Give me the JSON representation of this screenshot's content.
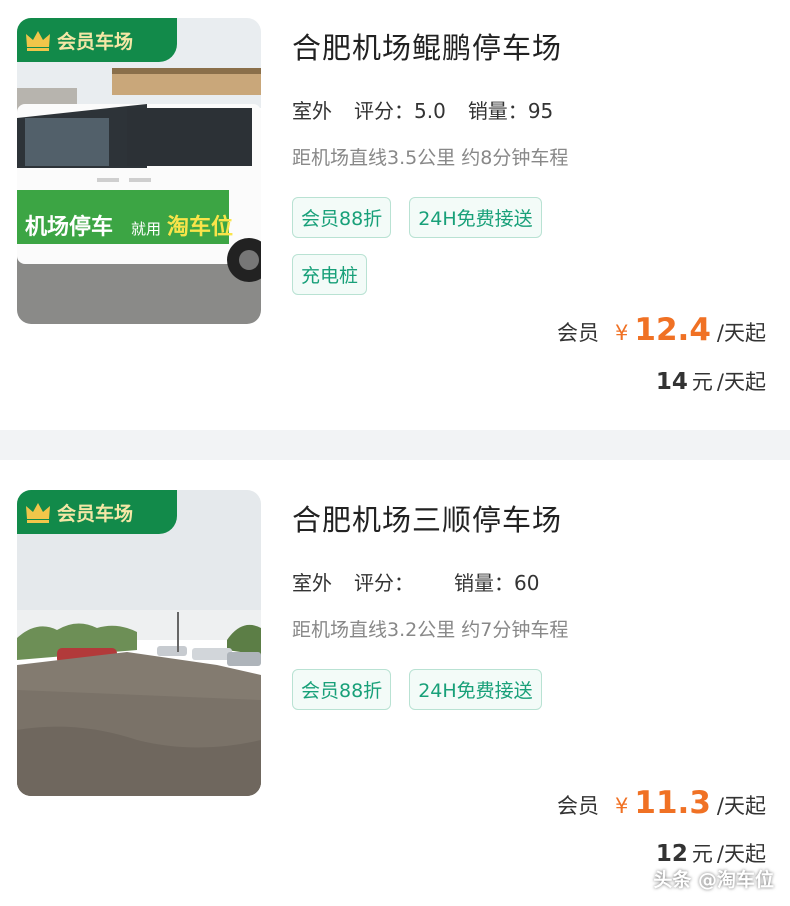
{
  "listings": [
    {
      "badge": "会员车场",
      "title": "合肥机场鲲鹏停车场",
      "kind": "室外",
      "rating_label": "评分：",
      "rating": "5.0",
      "sales_label": "销量：",
      "sales": "95",
      "distance": "距机场直线3.5公里 约8分钟车程",
      "tags": [
        "会员88折",
        "24H免费接送",
        "充电桩"
      ],
      "member_label": "会员",
      "currency": "¥",
      "member_price": "12.4",
      "per_day": "/天起",
      "base_price": "14",
      "base_unit": "元",
      "base_per_day": "/天起",
      "photo": {
        "van_text_1": "机场停车",
        "van_text_2": "就用",
        "van_text_3": "淘车位"
      }
    },
    {
      "badge": "会员车场",
      "title": "合肥机场三顺停车场",
      "kind": "室外",
      "rating_label": "评分：",
      "rating": "",
      "sales_label": "销量：",
      "sales": "60",
      "distance": "距机场直线3.2公里 约7分钟车程",
      "tags": [
        "会员88折",
        "24H免费接送"
      ],
      "member_label": "会员",
      "currency": "¥",
      "member_price": "11.3",
      "per_day": "/天起",
      "base_price": "12",
      "base_unit": "元",
      "base_per_day": "/天起"
    }
  ],
  "watermark": "头条 @淘车位",
  "colors": {
    "badge_bg": "#128a4a",
    "badge_text": "#f4e7a6",
    "tag_text": "#18a079",
    "price": "#f07124"
  }
}
